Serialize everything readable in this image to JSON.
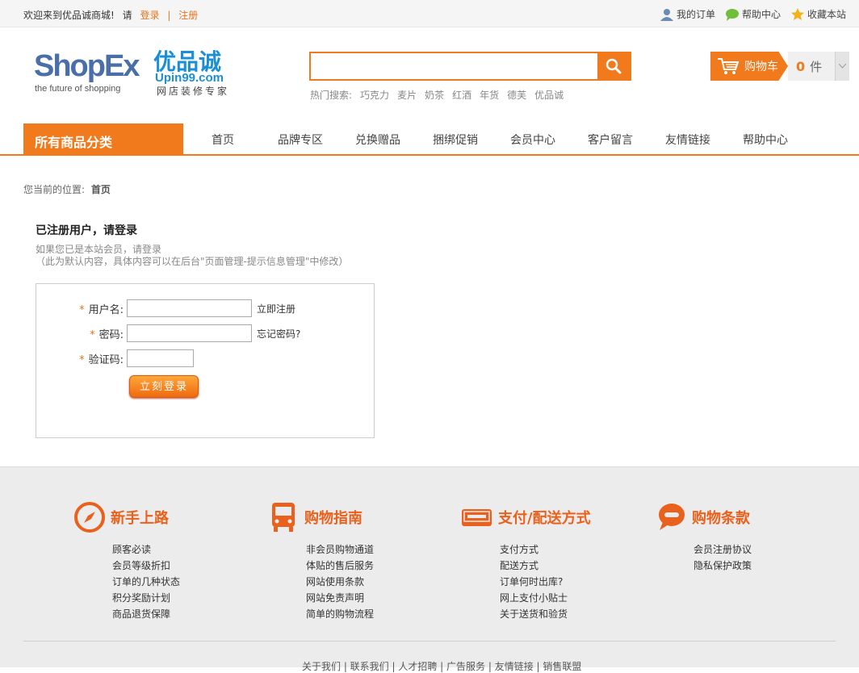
{
  "topbar": {
    "welcome": "欢迎来到优品诚商城!",
    "please": "请",
    "login": "登录",
    "separator": "|",
    "register": "注册",
    "links": [
      {
        "label": "我的订单",
        "icon": "user-icon"
      },
      {
        "label": "帮助中心",
        "icon": "chat-icon"
      },
      {
        "label": "收藏本站",
        "icon": "star-icon"
      }
    ]
  },
  "logo": {
    "brand": "ShopEx",
    "tagline": "the future of shopping",
    "cn_name": "优品诚",
    "domain": "Upin99.com",
    "slogan": "网店装修专家"
  },
  "search": {
    "value": "",
    "hot_label": "热门搜索:",
    "hot_words": [
      "巧克力",
      "麦片",
      "奶茶",
      "红酒",
      "年货",
      "德芙",
      "优品诚"
    ]
  },
  "cart": {
    "label": "购物车",
    "count": "0",
    "unit": "件"
  },
  "nav": {
    "category": "所有商品分类",
    "items": [
      "首页",
      "品牌专区",
      "兑换赠品",
      "捆绑促销",
      "会员中心",
      "客户留言",
      "友情链接",
      "帮助中心"
    ]
  },
  "breadcrumb": {
    "prefix": "您当前的位置:",
    "current": "首页"
  },
  "login": {
    "title": "已注册用户，请登录",
    "desc_line1": "如果您已是本站会员，请登录",
    "desc_line2": "（此为默认内容，具体内容可以在后台\"页面管理-提示信息管理\"中修改）",
    "required_mark": "*",
    "username_label": "用户名:",
    "username_value": "",
    "register_link": "立即注册",
    "password_label": "密码:",
    "password_value": "",
    "forgot_link": "忘记密码?",
    "captcha_label": "验证码:",
    "captcha_value": "",
    "submit": "立刻登录"
  },
  "footer": {
    "columns": [
      {
        "title": "新手上路",
        "icon": "compass-icon",
        "items": [
          "顾客必读",
          "会员等级折扣",
          "订单的几种状态",
          "积分奖励计划",
          "商品退货保障"
        ]
      },
      {
        "title": "购物指南",
        "icon": "bus-icon",
        "items": [
          "非会员购物通道",
          "体贴的售后服务",
          "网站使用条款",
          "网站免责声明",
          "简单的购物流程"
        ]
      },
      {
        "title": "支付/配送方式",
        "icon": "card-icon",
        "items": [
          "支付方式",
          "配送方式",
          "订单何时出库?",
          "网上支付小贴士",
          "关于送货和验货"
        ]
      },
      {
        "title": "购物条款",
        "icon": "speech-bubble-icon",
        "items": [
          "会员注册协议",
          "隐私保护政策"
        ]
      }
    ],
    "bottom_links": "关于我们 | 联系我们 | 人才招聘 | 广告服务 | 友情链接 | 销售联盟"
  },
  "colors": {
    "accent": "#f07a1c",
    "footer_bg": "#ececec"
  }
}
